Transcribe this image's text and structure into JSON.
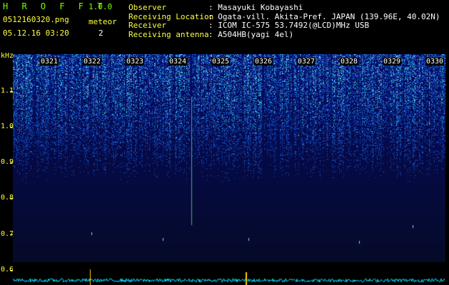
{
  "app": {
    "name": "H R O F F T",
    "version": "1.0.0"
  },
  "file": {
    "name": "0512160320.png",
    "datetime": "05.12.16 03:20"
  },
  "meteor": {
    "label": "meteor",
    "count": "2"
  },
  "info": [
    {
      "label": "Observer",
      "value": "Masayuki Kobayashi"
    },
    {
      "label": "Receiving Location",
      "value": "Ogata-vill. Akita-Pref. JAPAN (139.96E, 40.02N)"
    },
    {
      "label": "Receiver",
      "value": "ICOM IC-575 53.7492(@LCD)MHz USB"
    },
    {
      "label": "Receiving antenna",
      "value": "A504HB(yagi 4el)"
    }
  ],
  "y_axis": {
    "unit": "kHz",
    "ticks": [
      "1.1",
      "1.0",
      "0.9",
      "0.8",
      "0.7",
      "0.6"
    ]
  },
  "time_columns": [
    "0321",
    "0322",
    "0323",
    "0324",
    "0325",
    "0326",
    "0327",
    "0328",
    "0329",
    "0330"
  ],
  "colors": {
    "title": "#7cfc00",
    "label": "#ffff40",
    "text": "#ffffff",
    "spectrum_base": "#0a1a6a",
    "trace": "#00e5ff"
  }
}
